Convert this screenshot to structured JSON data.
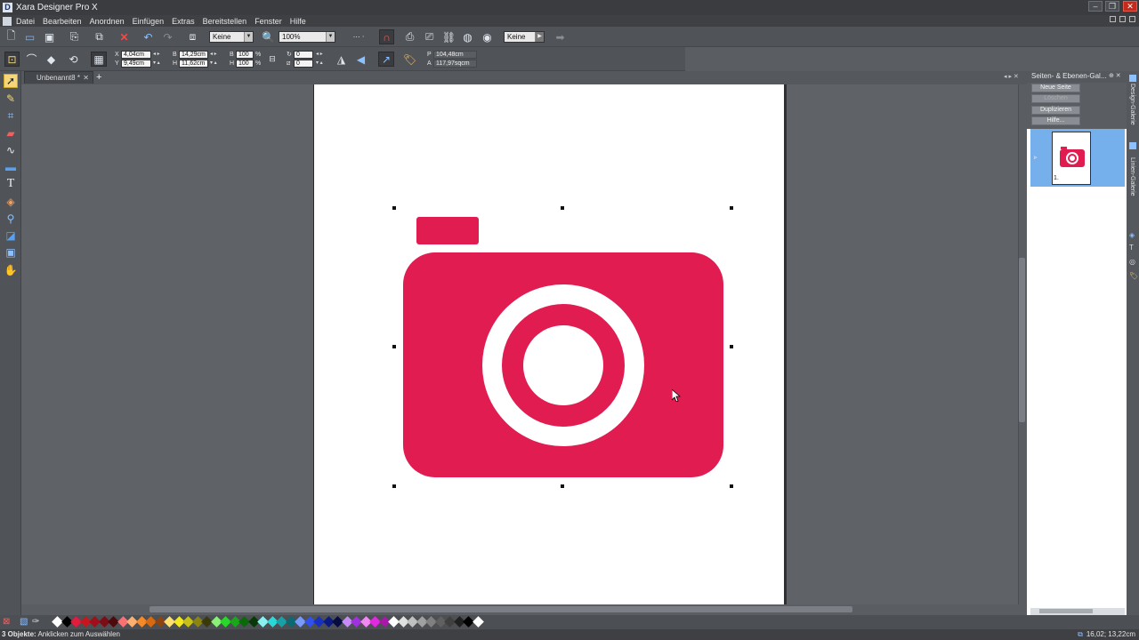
{
  "window": {
    "app_icon": "D",
    "title": "Xara Designer Pro X",
    "buttons": [
      "–",
      "❐",
      "✕"
    ]
  },
  "menu": [
    "Datei",
    "Bearbeiten",
    "Anordnen",
    "Einfügen",
    "Extras",
    "Bereitstellen",
    "Fenster",
    "Hilfe"
  ],
  "toolbar1": {
    "feather_value": "Keine",
    "zoom_value": "100%",
    "transparency_value": "Keine",
    "icons": [
      "new-document-icon",
      "open-icon",
      "save-icon",
      "import-icon",
      "paste-icon",
      "delete-icon",
      "undo-icon",
      "redo-icon",
      "zoom-to-page-icon",
      "zoom-icon",
      "snap-magnet-icon",
      "edit-page-icon",
      "web-icon",
      "link-icon",
      "globe-icon",
      "preview-icon",
      "forward-arrow-icon"
    ]
  },
  "toolbar2": {
    "x_label": "X",
    "x_value": "4,04cm",
    "y_label": "Y",
    "y_value": "9,49cm",
    "w_label": "B",
    "w_value": "14,29cm",
    "h_label": "H",
    "h_value": "11,62cm",
    "scale_w_label": "B",
    "scale_w_value": "100",
    "scale_h_label": "H",
    "scale_h_value": "100",
    "percent": "%",
    "rotate_value": "0",
    "skew_value": "0",
    "perimeter_label": "P",
    "perimeter_value": "104,48cm",
    "area_label": "A",
    "area_value": "117,97sqcm"
  },
  "tools": [
    "selector-tool-icon",
    "freehand-tool-icon",
    "crop-tool-icon",
    "eraser-tool-icon",
    "contour-tool-icon",
    "rectangle-tool-icon",
    "text-tool-icon",
    "fill-tool-icon",
    "transparency-tool-icon",
    "shadow-tool-icon",
    "bevel-tool-icon",
    "blend-tool-icon"
  ],
  "document_tab": {
    "label": "Unbenannt8 *",
    "close": "✕",
    "add": "+"
  },
  "camera": {
    "color": "#e01c50"
  },
  "panel": {
    "title": "Seiten- & Ebenen-Gal...",
    "buttons": [
      "Neue Seite",
      "Löschen",
      "Duplizieren",
      "Hilfe..."
    ],
    "page_number": "1."
  },
  "side_tabs": [
    "Design-Galerie",
    "Linien-Galerie"
  ],
  "status": {
    "bold": "3 Objekte:",
    "text": " Anklicken zum Auswählen",
    "coords": "16,02; 13,22cm"
  },
  "palette_colors": [
    "#ffffff",
    "#000000",
    "#e11c3c",
    "#c8161e",
    "#a0101a",
    "#7c0c16",
    "#4c0a0e",
    "#fb7070",
    "#fbb070",
    "#f58a2a",
    "#d66a10",
    "#8e4410",
    "#fde070",
    "#f2e820",
    "#c8c01a",
    "#8a8410",
    "#3a3a08",
    "#8af07a",
    "#2ad82a",
    "#18a818",
    "#0a6a0a",
    "#083808",
    "#8af0f0",
    "#2ad8d8",
    "#18a0a8",
    "#0a6a72",
    "#7a9af8",
    "#3050f0",
    "#1830c0",
    "#0c1a80",
    "#060c40",
    "#c88af8",
    "#a030e0",
    "#f08af0",
    "#e02ae0",
    "#a818a8",
    "#ffffff",
    "#e0e0e0",
    "#c0c0c0",
    "#a0a0a0",
    "#808080",
    "#606060",
    "#404040",
    "#202020",
    "#000000",
    "#ffffff"
  ]
}
